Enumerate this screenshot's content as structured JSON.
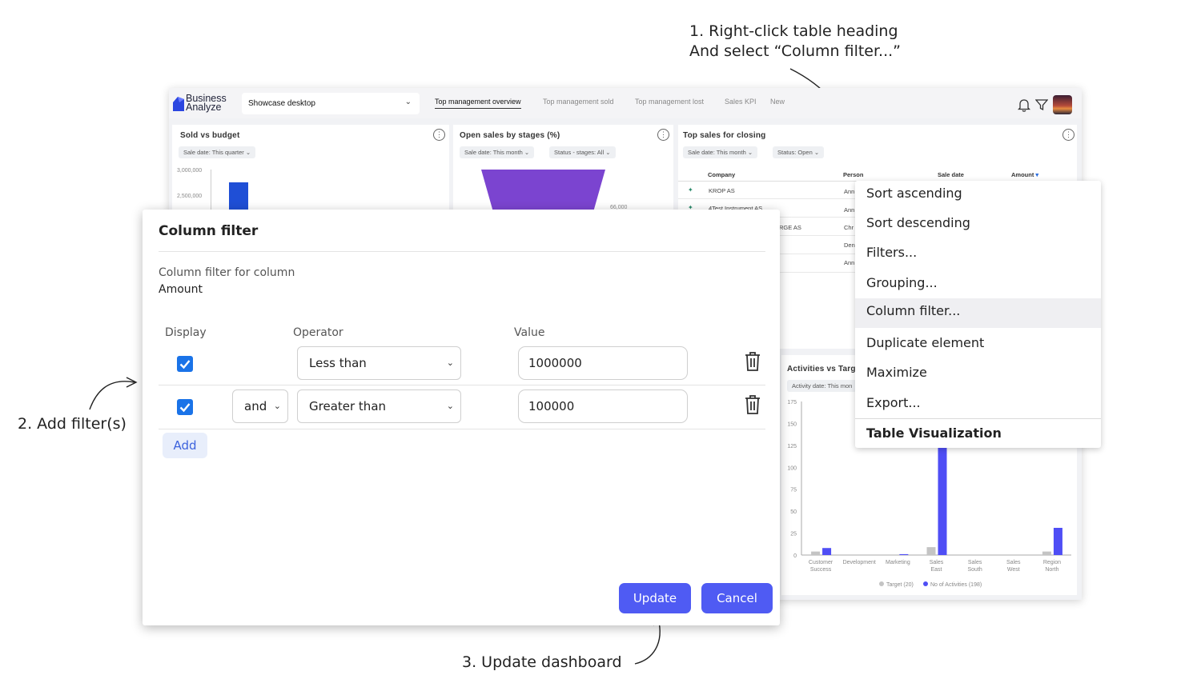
{
  "annotations": {
    "step1": [
      "1. Right-click table heading",
      "And select “Column filter...”"
    ],
    "step2": "2. Add filter(s)",
    "step3": "3. Update dashboard"
  },
  "app": {
    "logo": [
      "Business",
      "Analyze"
    ],
    "dashboard_select": "Showcase desktop",
    "tabs": [
      "Top management overview",
      "Top management sold",
      "Top management lost",
      "Sales KPI",
      "New"
    ],
    "active_tab": "Top management overview"
  },
  "panels": {
    "sold_vs_budget": {
      "title": "Sold vs budget",
      "chip": "Sale date:  This quarter",
      "y_ticks": [
        "3,000,000",
        "2,500,000"
      ],
      "accent": "#1f4fd6"
    },
    "open_sales": {
      "title": "Open sales by stages (%)",
      "chips": [
        "Sale date:  This month",
        "Status - stages:  All"
      ],
      "label_partial": "66,000",
      "accent": "#7b44d0"
    },
    "top_sales": {
      "title": "Top sales for closing",
      "chips": [
        "Sale date:  This month",
        "Status:  Open"
      ],
      "headers": [
        "Company",
        "Person",
        "Sale date",
        "Amount"
      ],
      "rows": [
        {
          "company": "KROP AS",
          "person": "Ann"
        },
        {
          "company": "4Test Instrument AS",
          "person": "Ann"
        },
        {
          "company": "RGE AS",
          "person": "Chr"
        },
        {
          "company": "",
          "person": "Den"
        },
        {
          "company": "",
          "person": "Ann"
        }
      ]
    },
    "activities": {
      "title": "Activities vs Targ",
      "chip": "Activity date:  This mon",
      "y_ticks": [
        "175",
        "150",
        "125",
        "100",
        "75",
        "50",
        "25",
        "0"
      ],
      "categories": [
        "Customer Success",
        "Development",
        "Marketing",
        "Sales East",
        "Sales South",
        "Sales West",
        "Region North"
      ],
      "legend": [
        "Target (20)",
        "No of Activities (198)"
      ]
    }
  },
  "chart_data": {
    "type": "bar",
    "categories": [
      "Customer Success",
      "Development",
      "Marketing",
      "Sales East",
      "Sales South",
      "Sales West",
      "Region North"
    ],
    "series": [
      {
        "name": "Target (20)",
        "values": [
          4,
          0,
          0,
          9,
          0,
          0,
          4
        ],
        "color": "#c4c4c4"
      },
      {
        "name": "No of Activities (198)",
        "values": [
          8,
          0,
          1,
          150,
          0,
          0,
          31
        ],
        "color": "#4f4ef5"
      }
    ],
    "ylim": [
      0,
      175
    ],
    "yticks": [
      0,
      25,
      50,
      75,
      100,
      125,
      150,
      175
    ]
  },
  "context_menu": {
    "items": [
      "Sort ascending",
      "Sort descending",
      "Filters...",
      "Grouping...",
      "Column filter...",
      "Duplicate element",
      "Maximize",
      "Export...",
      "Table Visualization"
    ],
    "highlighted": "Column filter..."
  },
  "dialog": {
    "title": "Column filter",
    "subtitle": "Column filter for column",
    "column_name": "Amount",
    "headers": {
      "display": "Display",
      "operator": "Operator",
      "value": "Value"
    },
    "rows": [
      {
        "checked": true,
        "connector": "",
        "operator": "Less than",
        "value": "1000000"
      },
      {
        "checked": true,
        "connector": "and",
        "operator": "Greater than",
        "value": "100000"
      }
    ],
    "add_label": "Add",
    "update_label": "Update",
    "cancel_label": "Cancel"
  }
}
